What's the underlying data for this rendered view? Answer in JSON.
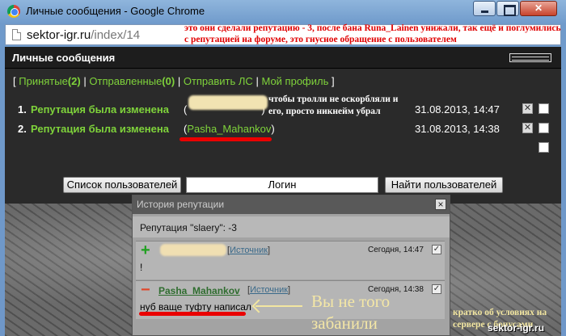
{
  "window": {
    "title": "Личные сообщения - Google Chrome",
    "url_host": "sektor-igr.ru",
    "url_path": "/index/14"
  },
  "annotations": {
    "top_note": "это они сделали репутацию - 3, после бана Runa_Lainen унижали, так ещё и поглумились с репутацией на форуме, это гнусное обращение с пользователем",
    "middle_note": "чтобы тролли не оскорбляли и его, просто никнейм убрал",
    "big_note": "Вы не того забанили",
    "side_note": "кратко об условиях на сервере с бонусами",
    "watermark": "sektor-igr.ru"
  },
  "pm": {
    "title": "Личные сообщения",
    "nav": {
      "open_bracket": "[",
      "inbox_label": "Принятые",
      "inbox_count": "(2)",
      "sep": "|",
      "sent_label": "Отправленные",
      "sent_count": "(0)",
      "compose_label": "Отправить ЛС",
      "profile_label": "Мой профиль",
      "close_bracket": "]"
    },
    "messages": [
      {
        "num": "1.",
        "subject": "Репутация была изменена",
        "sender": "",
        "date": "31.08.2013, 14:47"
      },
      {
        "num": "2.",
        "subject": "Репутация была изменена",
        "sender": "Pasha_Mahankov",
        "date": "31.08.2013, 14:38"
      }
    ],
    "search": {
      "users_button": "Список пользователей",
      "login_value": "Логин",
      "find_button": "Найти пользователей"
    }
  },
  "reputation_dialog": {
    "title": "История репутации",
    "close": "×",
    "summary": "Репутация \"slaery\": -3",
    "entries": [
      {
        "sign": "+",
        "user": "",
        "source": "Источник",
        "time": "Сегодня, 14:47",
        "body": "!"
      },
      {
        "sign": "−",
        "user": "Pasha_Mahankov",
        "source": "Источник",
        "time": "Сегодня, 14:38",
        "body": "нуб ваще туфту написал"
      }
    ]
  },
  "colors": {
    "accent_green": "#7fd33b",
    "annotation_red": "#e00000",
    "underline_red": "#ea0000"
  }
}
